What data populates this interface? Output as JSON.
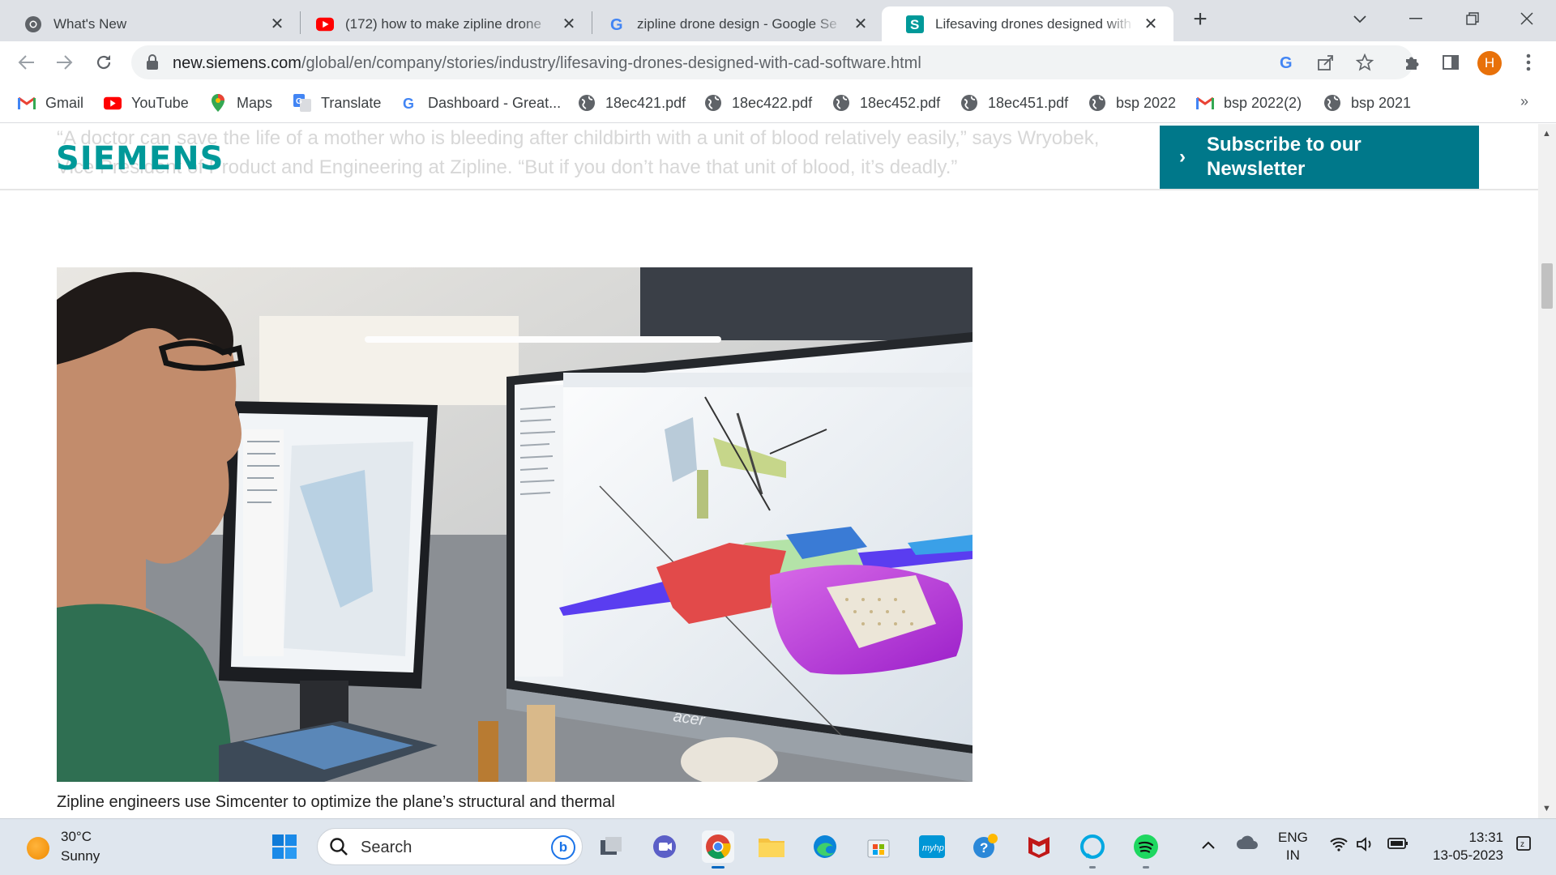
{
  "tabs": [
    {
      "title": "What's New",
      "icon": "chrome-icon",
      "active": false
    },
    {
      "title": "(172) how to make zipline drone",
      "icon": "youtube-icon",
      "active": false
    },
    {
      "title": "zipline drone design - Google Se",
      "icon": "google-icon",
      "active": false
    },
    {
      "title": "Lifesaving drones designed with",
      "icon": "siemens-s-icon",
      "active": true
    }
  ],
  "toolbar": {
    "url_host": "new.siemens.com",
    "url_path": "/global/en/company/stories/industry/lifesaving-drones-designed-with-cad-software.html",
    "profile_initial": "H"
  },
  "bookmarks": [
    {
      "label": "Gmail",
      "icon": "gmail-icon"
    },
    {
      "label": "YouTube",
      "icon": "youtube-icon"
    },
    {
      "label": "Maps",
      "icon": "maps-icon"
    },
    {
      "label": "Translate",
      "icon": "translate-icon"
    },
    {
      "label": "Dashboard - Great...",
      "icon": "google-icon"
    },
    {
      "label": "18ec421.pdf",
      "icon": "globe-icon"
    },
    {
      "label": "18ec422.pdf",
      "icon": "globe-icon"
    },
    {
      "label": "18ec452.pdf",
      "icon": "globe-icon"
    },
    {
      "label": "18ec451.pdf",
      "icon": "globe-icon"
    },
    {
      "label": "bsp 2022",
      "icon": "globe-icon"
    },
    {
      "label": "bsp 2022(2)",
      "icon": "gmail-icon"
    },
    {
      "label": "bsp 2021",
      "icon": "globe-icon"
    }
  ],
  "page": {
    "quote_line1": "“A doctor can save the life of a mother who is bleeding after childbirth with a unit of blood relatively easily,” says Wryobek,",
    "quote_line2": "Vice President of Product and Engineering at Zipline. “But if you don’t have that unit of blood, it’s deadly.”",
    "logo": "SIEMENS",
    "newsletter_label": "Subscribe to our Newsletter",
    "caption": "Zipline engineers use Simcenter to optimize the plane’s structural and thermal",
    "monitor_brand": "acer"
  },
  "taskbar": {
    "weather_temp": "30°C",
    "weather_cond": "Sunny",
    "search_label": "Search",
    "lang_line1": "ENG",
    "lang_line2": "IN",
    "time": "13:31",
    "date": "13-05-2023"
  },
  "colors": {
    "siemens_teal": "#009999",
    "newsletter_bg": "#00788a",
    "avatar": "#e8710a"
  }
}
